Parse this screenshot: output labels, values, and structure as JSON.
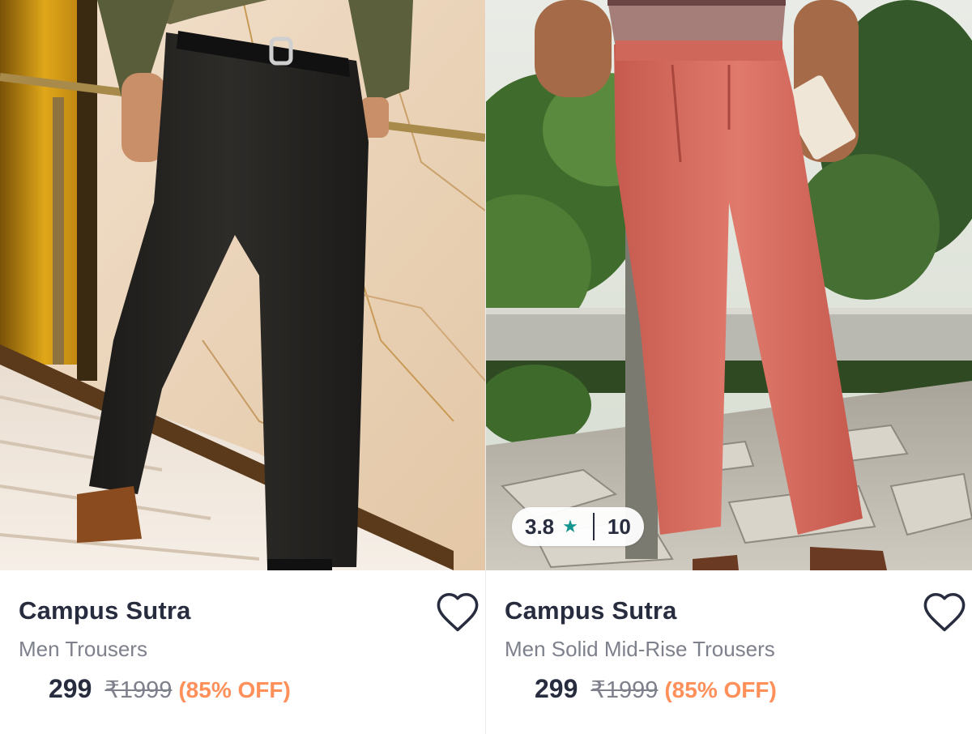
{
  "products": [
    {
      "brand": "Campus Sutra",
      "name": "Men Trousers",
      "price": "299",
      "mrp": "₹1999",
      "discount": "(85% OFF)",
      "image": "black-trousers-photo",
      "wishlist_icon": "heart-icon"
    },
    {
      "brand": "Campus Sutra",
      "name": "Men Solid Mid-Rise Trousers",
      "price": "299",
      "mrp": "₹1999",
      "discount": "(85% OFF)",
      "image": "pink-trousers-photo",
      "wishlist_icon": "heart-icon",
      "rating": {
        "value": "3.8",
        "star_icon": "star-icon",
        "count": "10"
      }
    }
  ],
  "colors": {
    "text_primary": "#282c3f",
    "text_secondary": "#7e818c",
    "discount": "#ff905a",
    "star": "#14958f"
  }
}
